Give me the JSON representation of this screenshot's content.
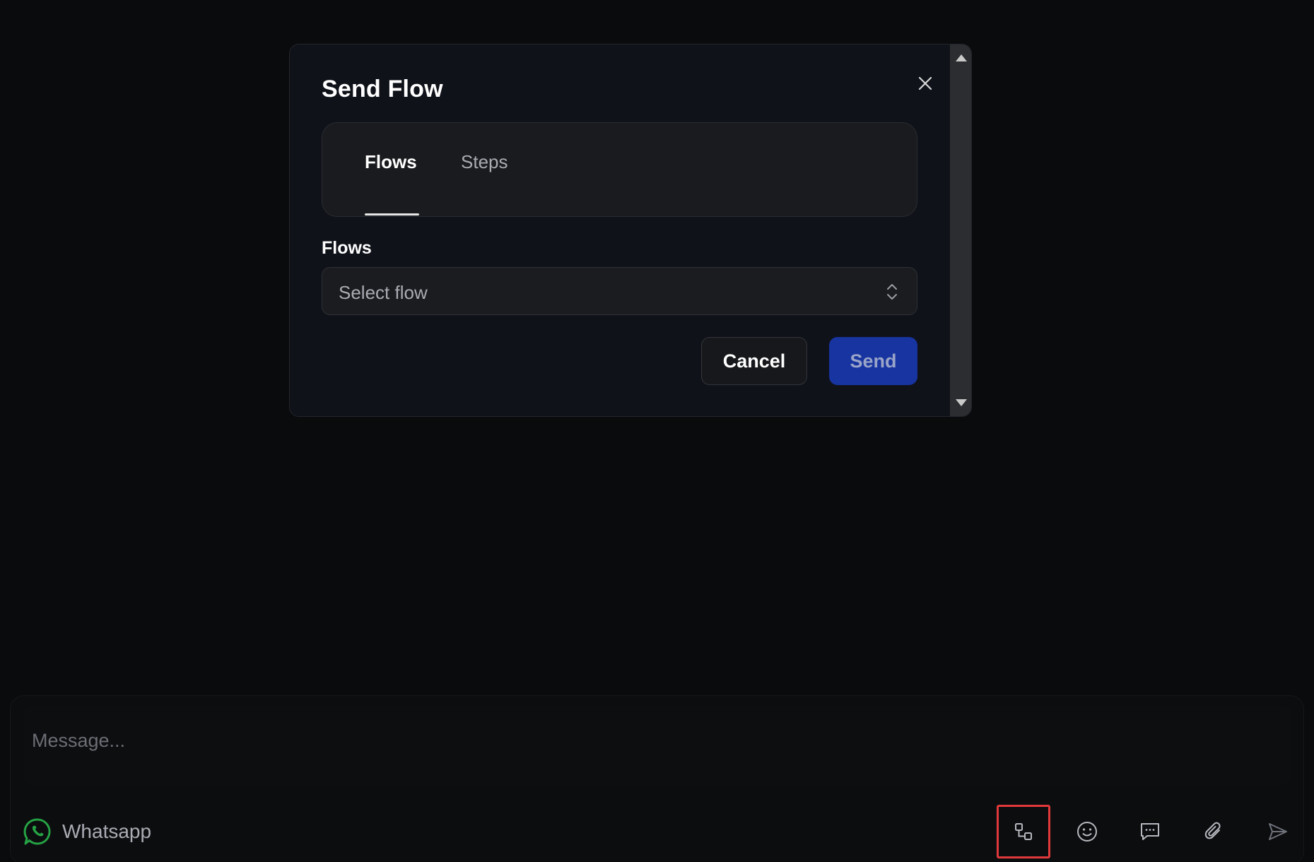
{
  "modal": {
    "title": "Send Flow",
    "tabs": [
      {
        "label": "Flows",
        "active": true
      },
      {
        "label": "Steps",
        "active": false
      }
    ],
    "field_label": "Flows",
    "select_placeholder": "Select flow",
    "cancel_label": "Cancel",
    "send_label": "Send",
    "close_icon": "close-icon"
  },
  "composer": {
    "placeholder": "Message...",
    "channel_label": "Whatsapp",
    "channel_icon": "whatsapp-icon",
    "tools": [
      {
        "icon": "flow-icon",
        "highlighted": true
      },
      {
        "icon": "emoji-icon"
      },
      {
        "icon": "message-template-icon"
      },
      {
        "icon": "attachment-icon"
      },
      {
        "icon": "send-icon"
      }
    ]
  },
  "colors": {
    "background": "#0a0b0d",
    "modal_bg": "#10121a",
    "send_button": "#1734a0",
    "highlight": "#e0393b",
    "whatsapp_green": "#25a244"
  }
}
